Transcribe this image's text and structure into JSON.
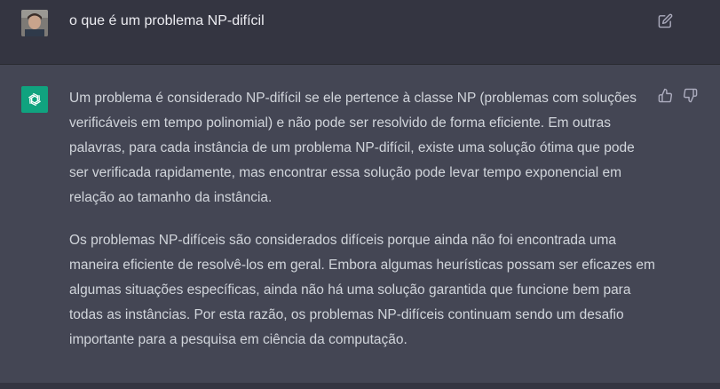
{
  "user_message": {
    "text": "o que é um problema NP-difícil"
  },
  "assistant_message": {
    "paragraphs": [
      "Um problema é considerado NP-difícil se ele pertence à classe NP (problemas com soluções verificáveis em tempo polinomial) e não pode ser resolvido de forma eficiente. Em outras palavras, para cada instância de um problema NP-difícil, existe uma solução ótima que pode ser verificada rapidamente, mas encontrar essa solução pode levar tempo exponencial em relação ao tamanho da instância.",
      "Os problemas NP-difíceis são considerados difíceis porque ainda não foi encontrada uma maneira eficiente de resolvê-los em geral. Embora algumas heurísticas possam ser eficazes em algumas situações específicas, ainda não há uma solução garantida que funcione bem para todas as instâncias. Por esta razão, os problemas NP-difíceis continuam sendo um desafio importante para a pesquisa em ciência da computação."
    ]
  },
  "icons": {
    "edit": "edit-icon",
    "thumb_up": "thumbs-up-icon",
    "thumb_down": "thumbs-down-icon",
    "bot": "openai-logo-icon"
  },
  "colors": {
    "user_bg": "#343541",
    "assistant_bg": "#444654",
    "bot_avatar": "#10a37f",
    "text": "#d1d5db"
  }
}
